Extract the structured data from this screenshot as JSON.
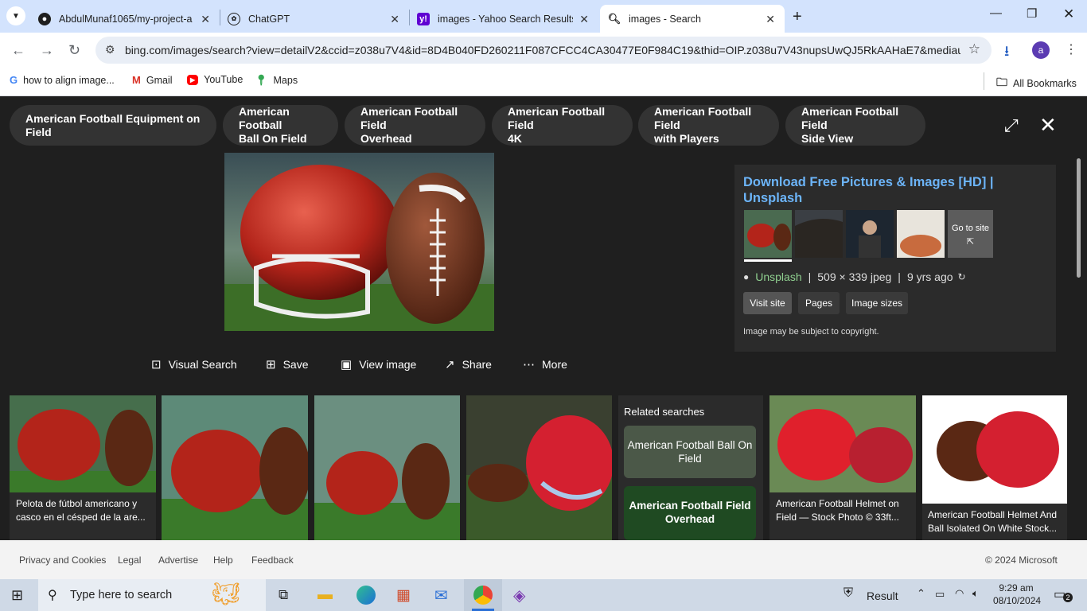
{
  "browser": {
    "tabs": [
      {
        "label": "AbdulMunaf1065/my-project-a",
        "icon": "github-icon"
      },
      {
        "label": "ChatGPT",
        "icon": "chatgpt-icon"
      },
      {
        "label": "images - Yahoo Search Results",
        "icon": "yahoo-icon"
      },
      {
        "label": "images - Search",
        "icon": "search-icon",
        "active": true
      }
    ],
    "url": "bing.com/images/search?view=detailV2&ccid=z038u7V4&id=8D4B040FD260211F087CFCC4CA30477E0F984C19&thid=OIP.z038u7V43nupsUwQJ5RkAAHaE7&mediaur...",
    "profile_initial": "a",
    "bookmarks": [
      {
        "label": "how to align image...",
        "icon": "google-icon"
      },
      {
        "label": "Gmail",
        "icon": "gmail-icon"
      },
      {
        "label": "YouTube",
        "icon": "youtube-icon"
      },
      {
        "label": "Maps",
        "icon": "maps-icon"
      }
    ],
    "all_bookmarks": "All Bookmarks"
  },
  "viewer": {
    "pills": [
      [
        "American Football Equipment on Field"
      ],
      [
        "American Football",
        "Ball On Field"
      ],
      [
        "American Football Field",
        "Overhead"
      ],
      [
        "American Football Field",
        "4K"
      ],
      [
        "American Football Field",
        "with Players"
      ],
      [
        "American Football Field",
        "Side View"
      ]
    ],
    "actions": [
      "Visual Search",
      "Save",
      "View image",
      "Share",
      "More"
    ],
    "info": {
      "title_line1": "Download Free Pictures & Images [HD] |",
      "title_line2": "Unsplash",
      "go_to_site": "Go to site",
      "source": "Unsplash",
      "dims": "509 × 339 jpeg",
      "age": "9 yrs ago",
      "buttons": [
        "Visit site",
        "Pages",
        "Image sizes"
      ],
      "copyright": "Image may be subject to copyright."
    },
    "thumbs": [
      {
        "caption": "Pelota de fútbol americano y casco en el césped de la are..."
      },
      {
        "caption": ""
      },
      {
        "caption": ""
      },
      {
        "caption": ""
      }
    ],
    "related": {
      "heading": "Related searches",
      "items": [
        "American Football Ball On Field",
        "American Football Field Overhead"
      ]
    },
    "right_thumbs": [
      {
        "caption": "American Football Helmet on Field — Stock Photo © 33ft..."
      },
      {
        "caption": "American Football Helmet And Ball Isolated On White Stock..."
      }
    ]
  },
  "footer": {
    "links": [
      "Privacy and Cookies",
      "Legal",
      "Advertise",
      "Help",
      "Feedback"
    ],
    "copyright": "© 2024 Microsoft"
  },
  "taskbar": {
    "search_placeholder": "Type here to search",
    "result_label": "Result",
    "time": "9:29 am",
    "date": "08/10/2024",
    "notifications": "2"
  }
}
